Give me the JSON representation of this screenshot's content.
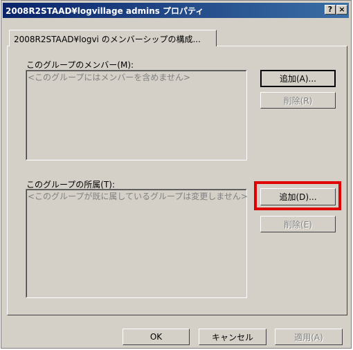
{
  "window": {
    "title": "2008R2STAAD¥logvillage admins プロパティ",
    "help_button": "?",
    "close_button": "×"
  },
  "tab": {
    "label": "2008R2STAAD¥logvi のメンバーシップの構成..."
  },
  "members": {
    "label": "このグループのメンバー(M):",
    "empty_text": "<このグループにはメンバーを含めません>",
    "add_button": "追加(A)...",
    "remove_button": "削除(R)"
  },
  "member_of": {
    "label": "このグループの所属(T):",
    "empty_text": "<このグループが既に属しているグループは変更しません>",
    "add_button": "追加(D)...",
    "remove_button": "削除(E)"
  },
  "footer": {
    "ok_button": "OK",
    "cancel_button": "キャンセル",
    "apply_button": "適用(A)"
  },
  "colors": {
    "highlight": "#e00000",
    "titlebar_start": "#0a246a",
    "titlebar_end": "#3a6ea5"
  }
}
